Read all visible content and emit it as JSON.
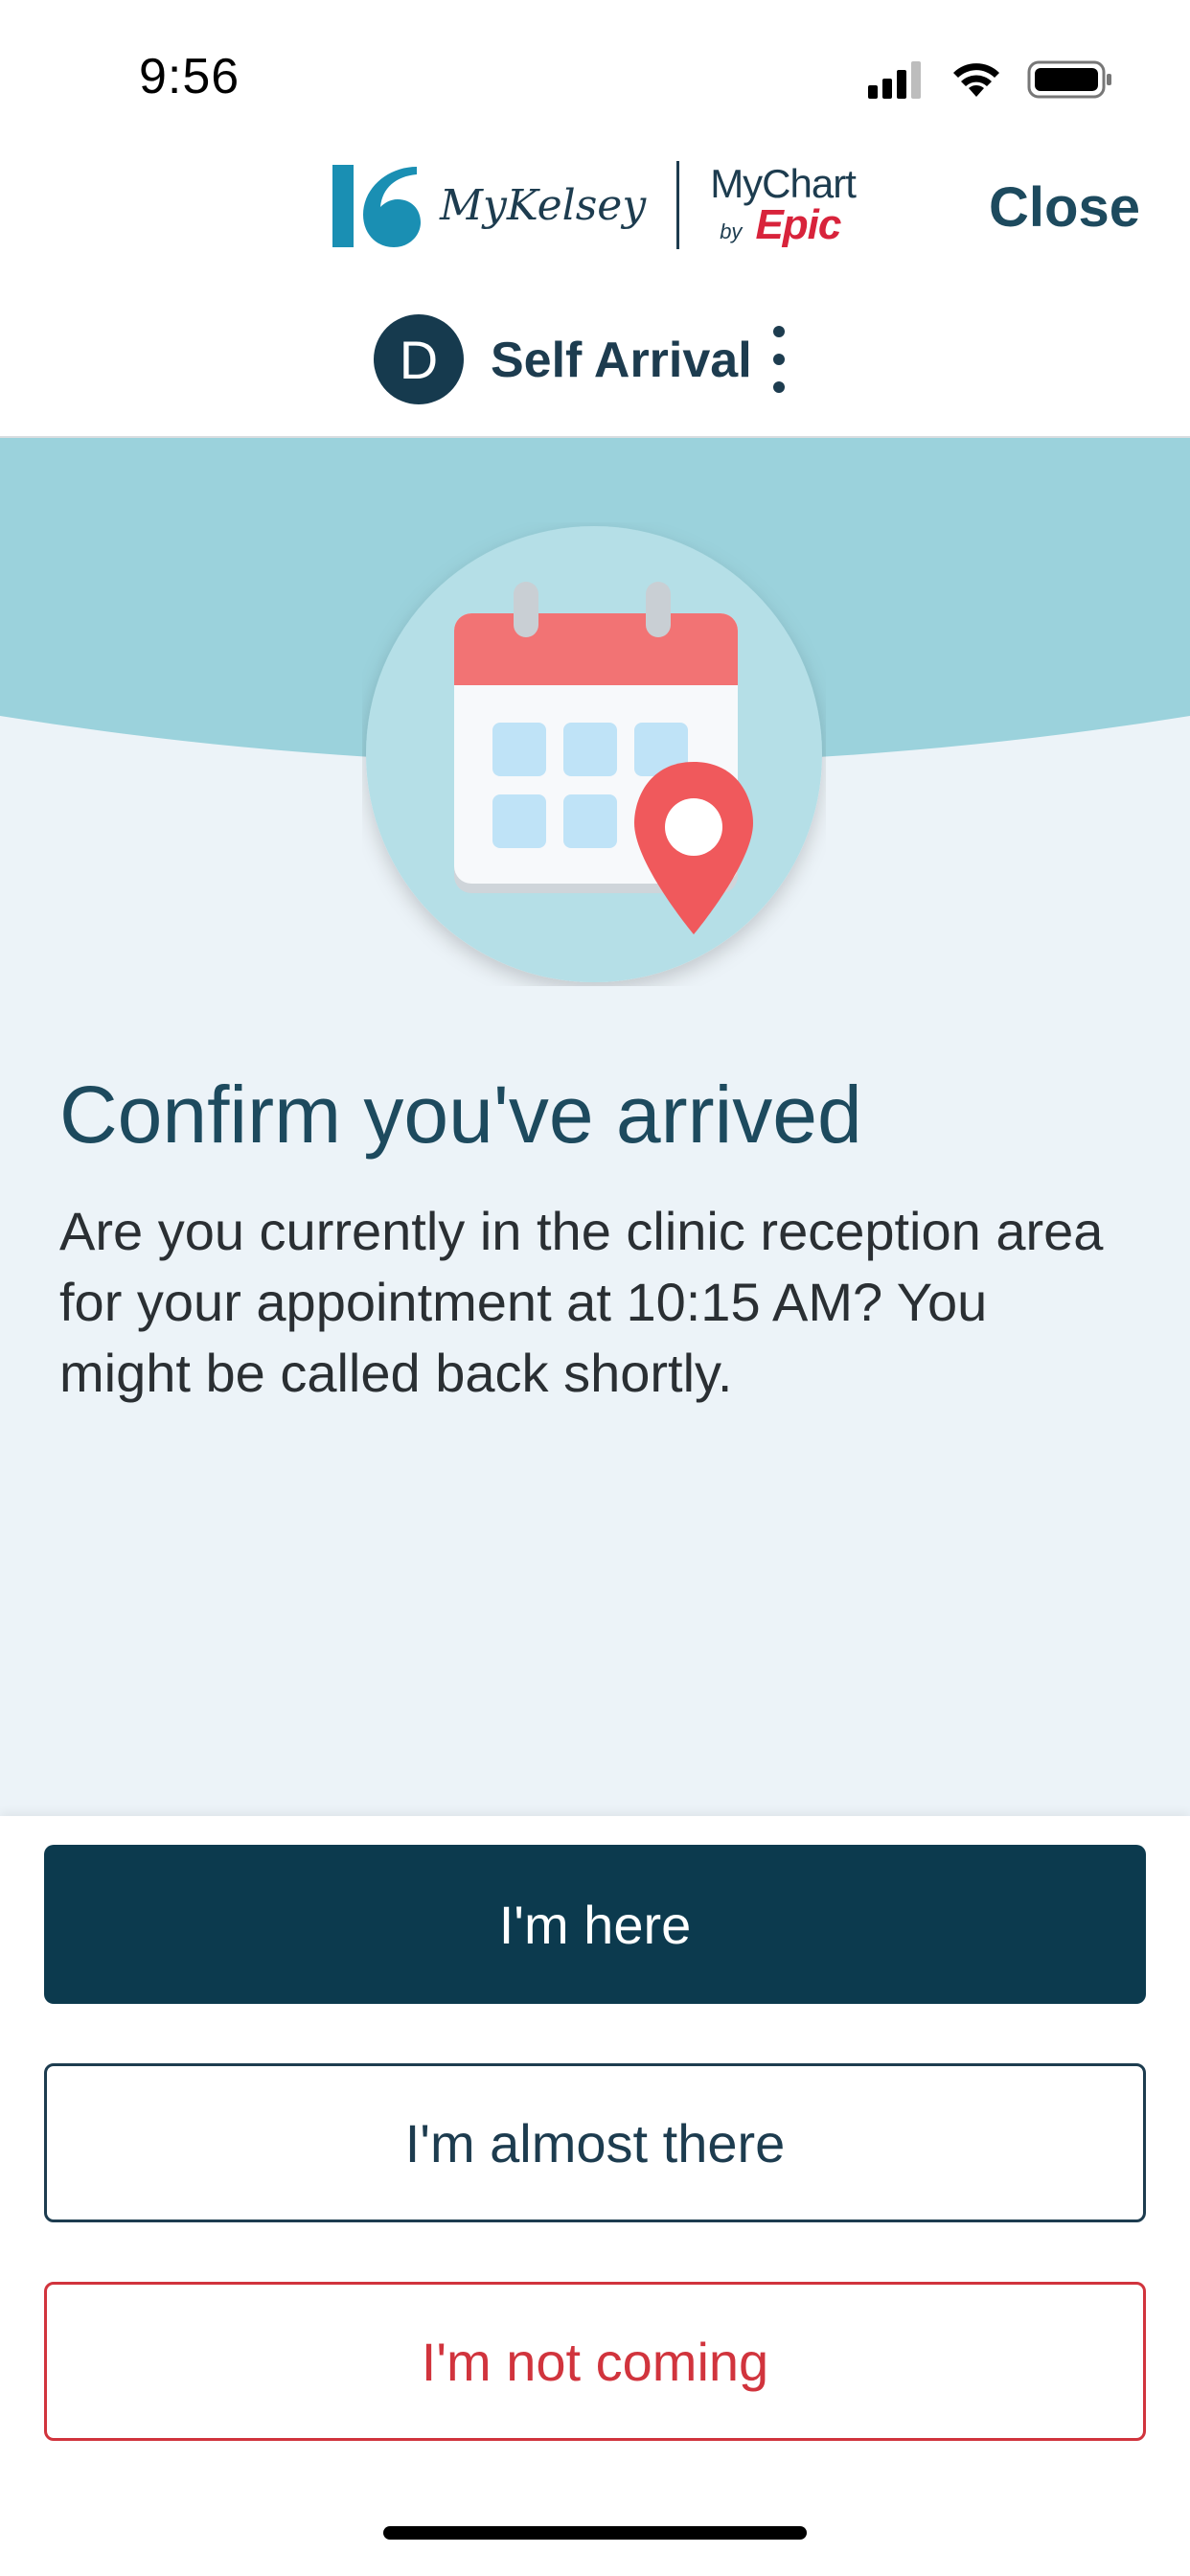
{
  "status_bar": {
    "time": "9:56",
    "icons": [
      "signal-icon",
      "wifi-icon",
      "battery-icon"
    ]
  },
  "header": {
    "brand_mykelsey": "MyKelsey",
    "brand_mychart": "MyChart",
    "brand_by": "by",
    "brand_epic": "Epic",
    "close_label": "Close",
    "avatar_initial": "D",
    "title": "Self Arrival",
    "more_icon": "more-vertical-icon"
  },
  "content": {
    "illustration_icon": "calendar-location-icon",
    "heading": "Confirm you've arrived",
    "message": "Are you currently in the clinic reception area for your appointment at 10:15 AM? You might be called back shortly."
  },
  "actions": {
    "here_label": "I'm here",
    "almost_label": "I'm almost there",
    "not_coming_label": "I'm not coming"
  },
  "colors": {
    "primary": "#0c3a4e",
    "text_dark": "#1d3c4f",
    "danger": "#d1343d",
    "wave": "#9bd2dc",
    "content_bg": "#ecf3f8",
    "epic_red": "#d8233b",
    "kelsey_blue": "#1a8fb3"
  }
}
